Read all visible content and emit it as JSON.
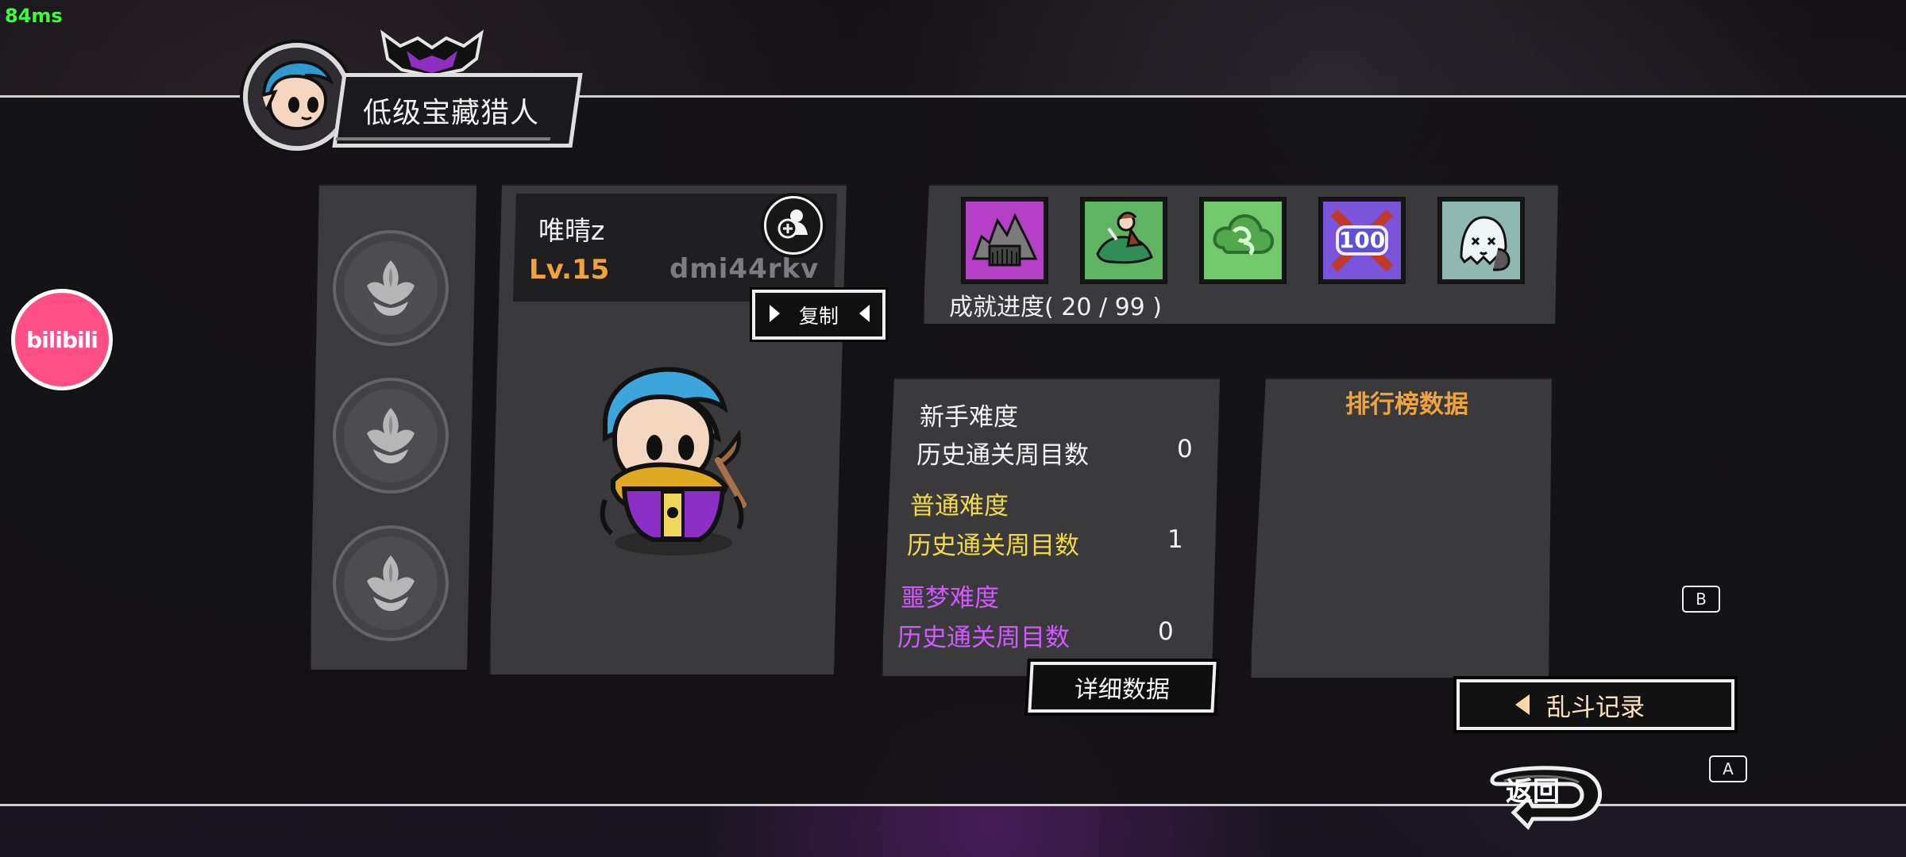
{
  "overlay": {
    "fps": "84ms"
  },
  "profile": {
    "rank_title": "低级宝藏猎人",
    "player_name": "唯晴z",
    "level": "Lv.15",
    "player_id": "dmi44rkv",
    "copy_label": "复制",
    "icons": {
      "avatar": "portrait-icon",
      "crest": "crest-icon",
      "add_friend": "add-friend-icon",
      "hero": "hero-character-icon"
    }
  },
  "side_slots": [
    {
      "name": "slot-1",
      "icon": "lotus-emblem-icon"
    },
    {
      "name": "slot-2",
      "icon": "lotus-emblem-icon"
    },
    {
      "name": "slot-3",
      "icon": "lotus-emblem-icon"
    }
  ],
  "achievements": {
    "progress_text": "成就进度( 20 / 99 )",
    "badges": [
      {
        "name": "achievement-1",
        "icon": "mountain-gate-icon",
        "label": ""
      },
      {
        "name": "achievement-2",
        "icon": "rider-icon",
        "label": ""
      },
      {
        "name": "achievement-3",
        "icon": "cloud-icon",
        "label": ""
      },
      {
        "name": "achievement-4",
        "icon": "hundred-badge-icon",
        "label": "100"
      },
      {
        "name": "achievement-5",
        "icon": "ghost-icon",
        "label": ""
      }
    ]
  },
  "difficulty_stats": [
    {
      "title": "新手难度",
      "label": "历史通关周目数",
      "value": "0",
      "color": "#f4f4f4"
    },
    {
      "title": "普通难度",
      "label": "历史通关周目数",
      "value": "1",
      "color": "#f2d84b"
    },
    {
      "title": "噩梦难度",
      "label": "历史通关周目数",
      "value": "0",
      "color": "#d259ff"
    }
  ],
  "leaderboard": {
    "title": "排行榜数据"
  },
  "buttons": {
    "detail": "详细数据",
    "melee_record": "乱斗记录",
    "back": "返回"
  },
  "hints": {
    "b": "B",
    "a": "A"
  },
  "brand": {
    "bili": "bilibili"
  },
  "colors": {
    "panel": "#3a3a3c",
    "accent_orange": "#f0a23d",
    "accent_yellow": "#f2d84b",
    "accent_purple": "#d259ff",
    "bili_pink": "#ff4f86"
  }
}
